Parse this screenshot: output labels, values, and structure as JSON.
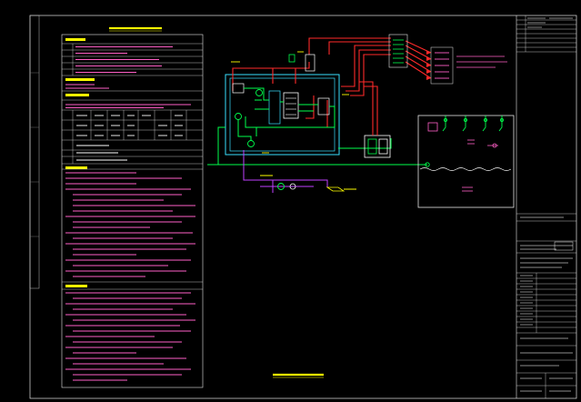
{
  "drawing": {
    "colors": {
      "background": "#000000",
      "frame": "#e6e6e6",
      "notes_heading": "#ffff00",
      "notes_text": "#ff5fc7",
      "pipe_supply": "#ff2a2a",
      "pipe_return": "#ff2a2a",
      "pipe_cold": "#00ff4c",
      "unit_outline": "#38e0ff",
      "drain": "#c040ff",
      "equipment": "#ffffff",
      "title_text": "#ffff00"
    }
  }
}
